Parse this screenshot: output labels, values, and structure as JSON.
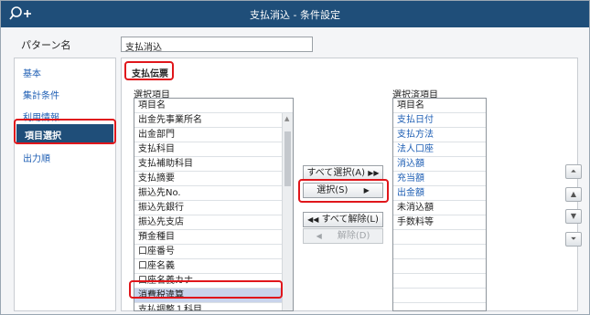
{
  "window": {
    "title": "支払消込 - 条件設定",
    "logo": "search-plus-icon"
  },
  "pattern": {
    "label": "パターン名",
    "value": "支払消込"
  },
  "sidebar": {
    "items": [
      {
        "label": "基本"
      },
      {
        "label": "集計条件"
      },
      {
        "label": "利用情報"
      },
      {
        "label": "項目選択"
      },
      {
        "label": "出力順"
      }
    ]
  },
  "section": {
    "title": "支払伝票"
  },
  "available": {
    "label": "選択項目",
    "header": "項目名",
    "items": [
      "出金先事業所名",
      "出金部門",
      "支払科目",
      "支払補助科目",
      "支払摘要",
      "振込先No.",
      "振込先銀行",
      "振込先支店",
      "預金種目",
      "口座番号",
      "口座名義",
      "口座名義カナ",
      "消費税違算",
      "支払調整１科目"
    ]
  },
  "selected": {
    "label": "選択済項目",
    "header": "項目名",
    "items": [
      "支払日付",
      "支払方法",
      "法人口座",
      "消込額",
      "充当額",
      "出金額",
      "未消込額",
      "手数料等"
    ]
  },
  "buttons": {
    "select_all": "すべて選択(A)",
    "select_all_icon": "▶▶",
    "select": "選択(S)",
    "select_icon": "▶",
    "deselect_all": "すべて解除(L)",
    "deselect_all_icon": "◀◀",
    "deselect": "解除(D)",
    "deselect_icon": "◀"
  },
  "order_buttons": {
    "top": "⏶",
    "up": "▲",
    "down": "▼",
    "bottom": "⏷"
  }
}
